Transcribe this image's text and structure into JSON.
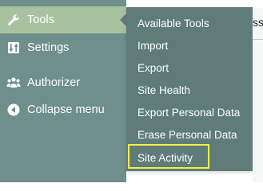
{
  "sidebar": {
    "items": [
      {
        "label": "Tools",
        "icon": "wrench-icon",
        "active": true
      },
      {
        "label": "Settings",
        "icon": "sliders-icon",
        "active": false
      },
      {
        "label": "Authorizer",
        "icon": "users-icon",
        "active": false
      },
      {
        "label": "Collapse menu",
        "icon": "collapse-arrow-icon",
        "active": false
      }
    ]
  },
  "flyout": {
    "items": [
      {
        "label": "Available Tools"
      },
      {
        "label": "Import"
      },
      {
        "label": "Export"
      },
      {
        "label": "Site Health"
      },
      {
        "label": "Export Personal Data"
      },
      {
        "label": "Erase Personal Data"
      },
      {
        "label": "Site Activity",
        "highlighted": true
      }
    ]
  },
  "right_panel": {
    "edge_text": "ss"
  },
  "colors": {
    "sidebar_bg": "#6e8f8c",
    "active_item_bg": "#a8c29f",
    "flyout_bg": "#5f7c79",
    "highlight_border": "#f0f04a",
    "text": "#ffffff"
  }
}
